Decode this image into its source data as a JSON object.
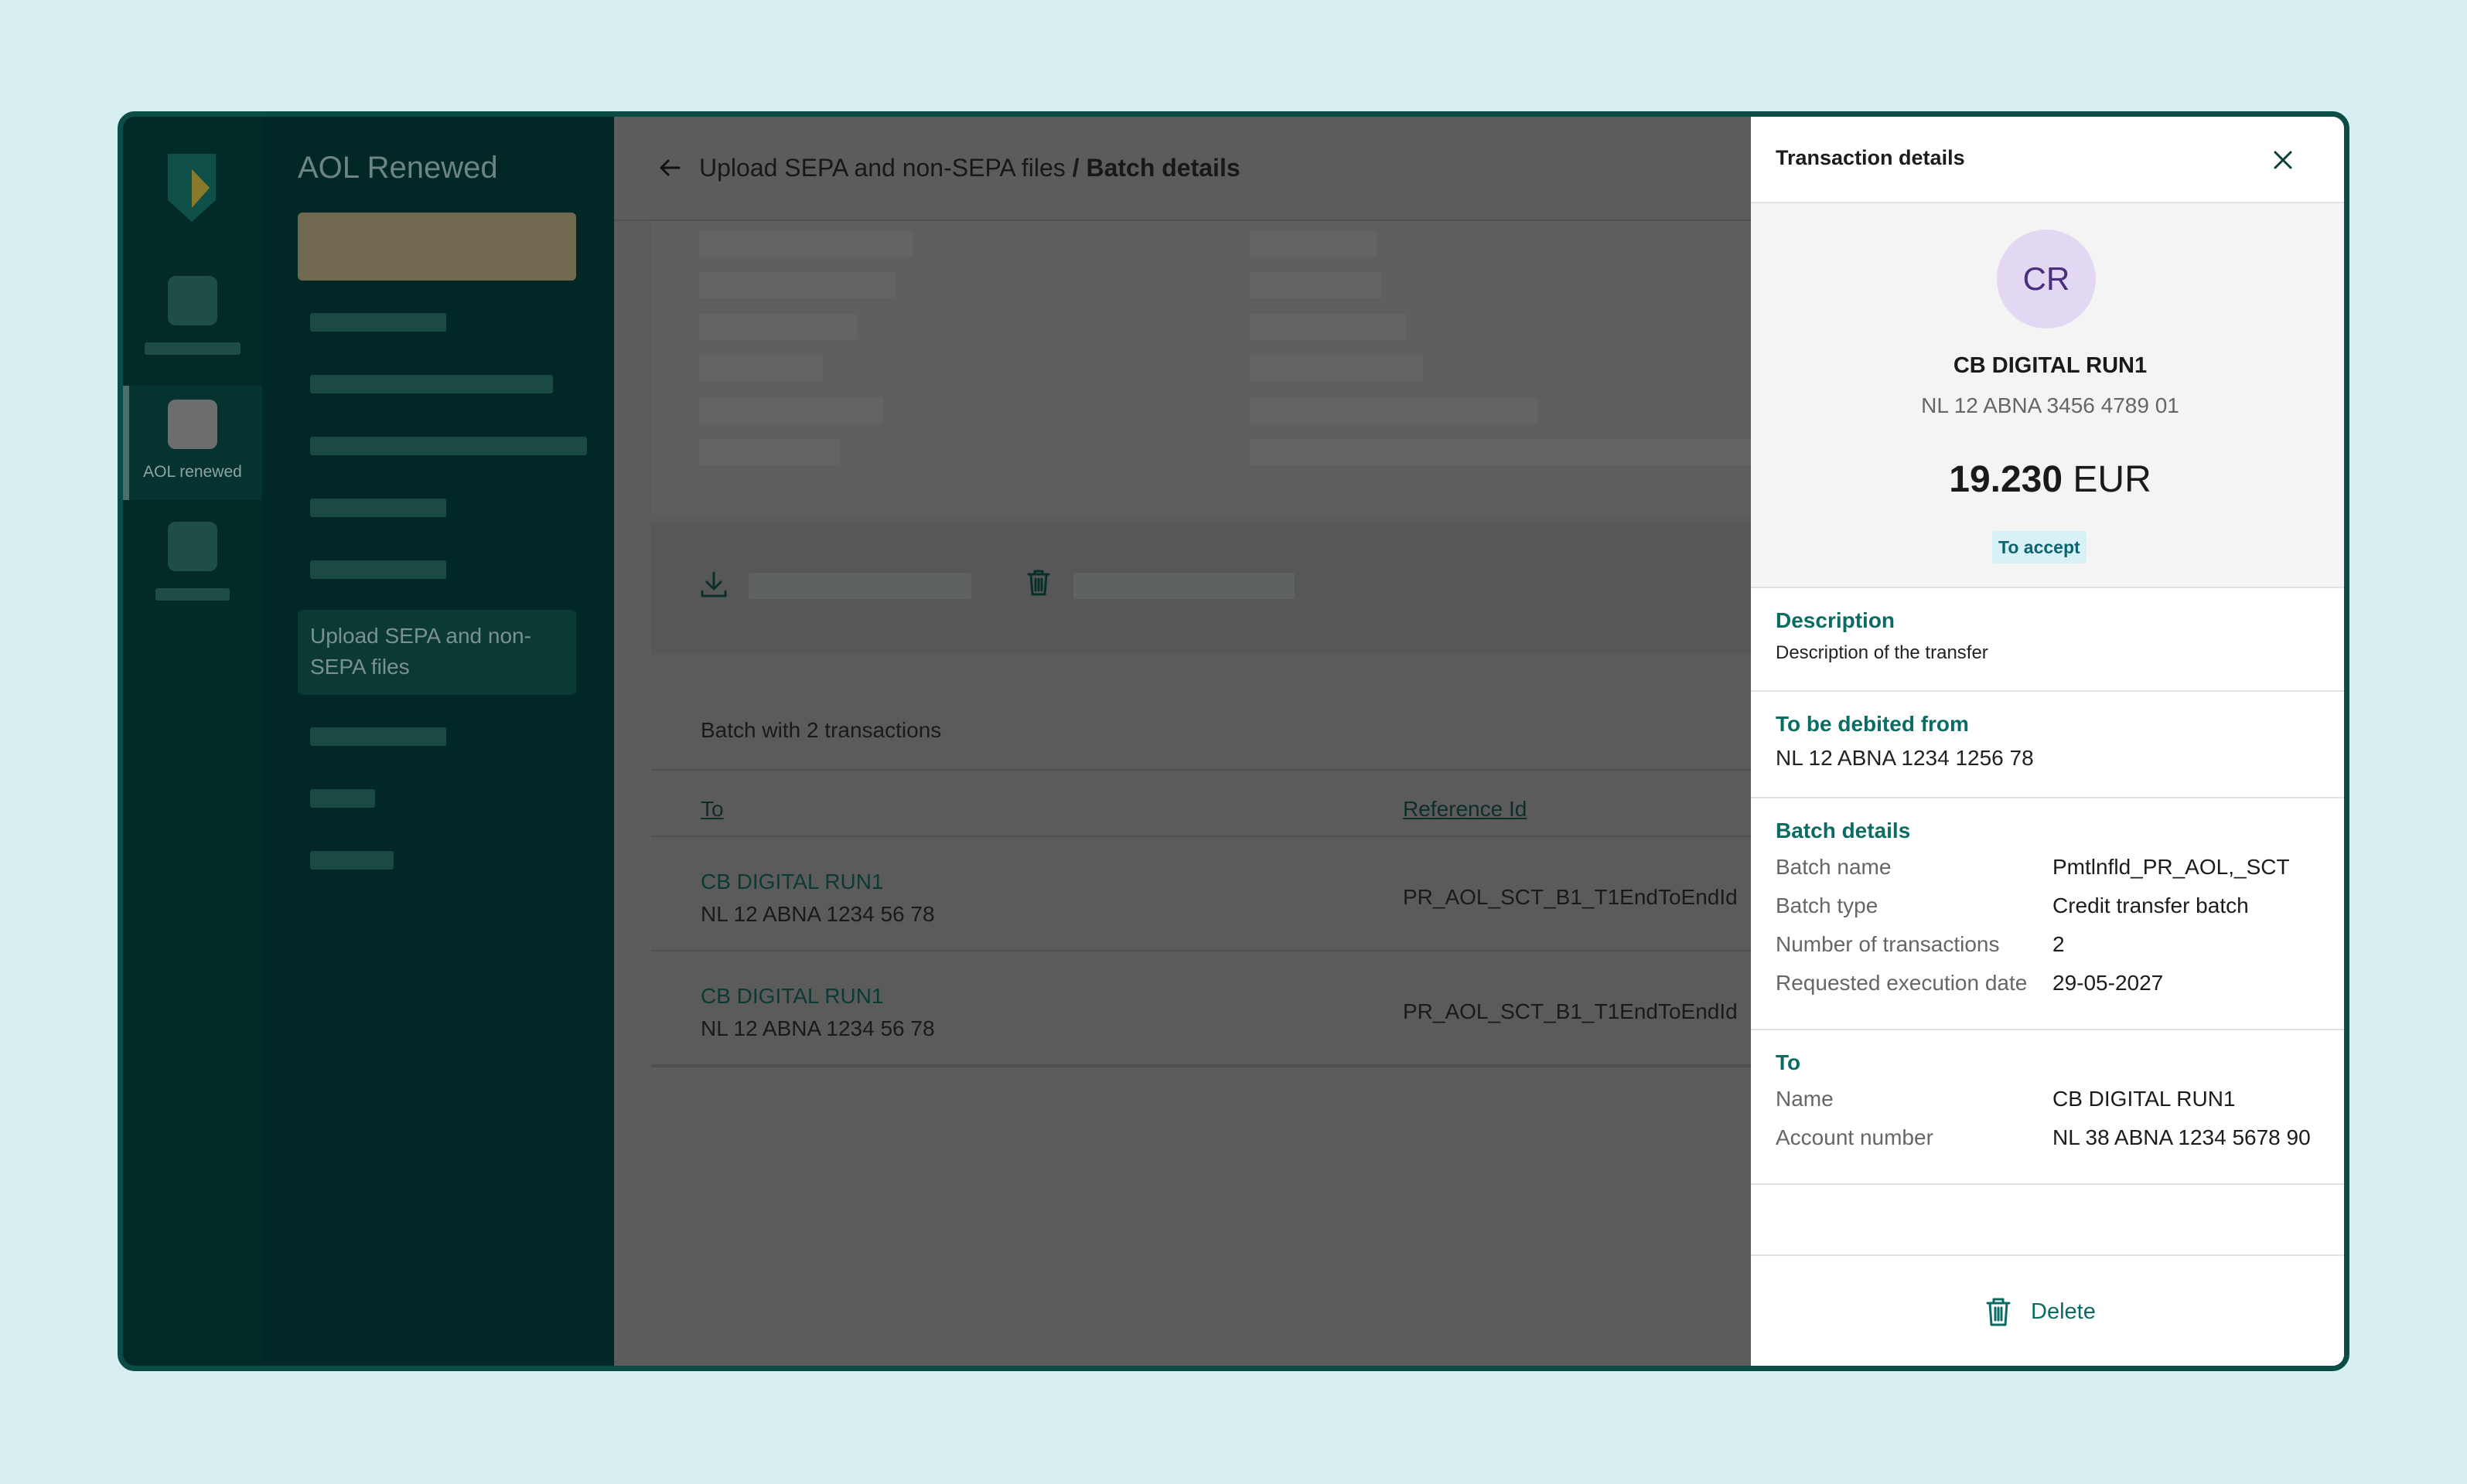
{
  "app": {
    "title": "AOL Renewed"
  },
  "rail": {
    "active_label": "AOL renewed"
  },
  "nav": {
    "active_item": "Upload SEPA and non-SEPA files"
  },
  "header": {
    "breadcrumb_parent": "Upload SEPA and non-SEPA files",
    "breadcrumb_current": "/ Batch details"
  },
  "table": {
    "title": "Batch with 2 transactions",
    "columns": {
      "to": "To",
      "reference": "Reference Id"
    },
    "rows": [
      {
        "name": "CB DIGITAL RUN1",
        "account": "NL 12 ABNA 1234 56 78",
        "reference": "PR_AOL_SCT_B1_T1EndToEndId"
      },
      {
        "name": "CB DIGITAL RUN1",
        "account": "NL 12 ABNA 1234 56 78",
        "reference": "PR_AOL_SCT_B1_T1EndToEndId"
      }
    ]
  },
  "drawer": {
    "title": "Transaction details",
    "avatar_initials": "CR",
    "counterparty_name": "CB DIGITAL RUN1",
    "counterparty_account": "NL 12 ABNA 3456 4789 01",
    "amount_value": "19.230",
    "amount_currency": "EUR",
    "status": "To accept",
    "description": {
      "title": "Description",
      "text": "Description of the transfer"
    },
    "debited": {
      "title": "To be debited from",
      "account": "NL 12 ABNA 1234 1256 78"
    },
    "batch": {
      "title": "Batch details",
      "rows": [
        {
          "label": "Batch name",
          "value": "Pmtlnfld_PR_AOL,_SCT"
        },
        {
          "label": "Batch type",
          "value": "Credit transfer batch"
        },
        {
          "label": "Number of transactions",
          "value": "2"
        },
        {
          "label": "Requested execution date",
          "value": "29-05-2027"
        }
      ]
    },
    "to": {
      "title": "To",
      "rows": [
        {
          "label": "Name",
          "value": "CB DIGITAL RUN1"
        },
        {
          "label": "Account number",
          "value": "NL 38 ABNA 1234 5678 90"
        }
      ]
    },
    "delete_label": "Delete"
  },
  "colors": {
    "accent": "#0a6c63",
    "status_bg": "#d7f1f6",
    "avatar_bg": "#e3d8f3",
    "frame_border": "#0b4c47",
    "page_bg": "#d7eff0"
  },
  "icons": [
    "bank-logo-icon",
    "arrow-left-icon",
    "download-icon",
    "trash-icon",
    "close-icon"
  ]
}
